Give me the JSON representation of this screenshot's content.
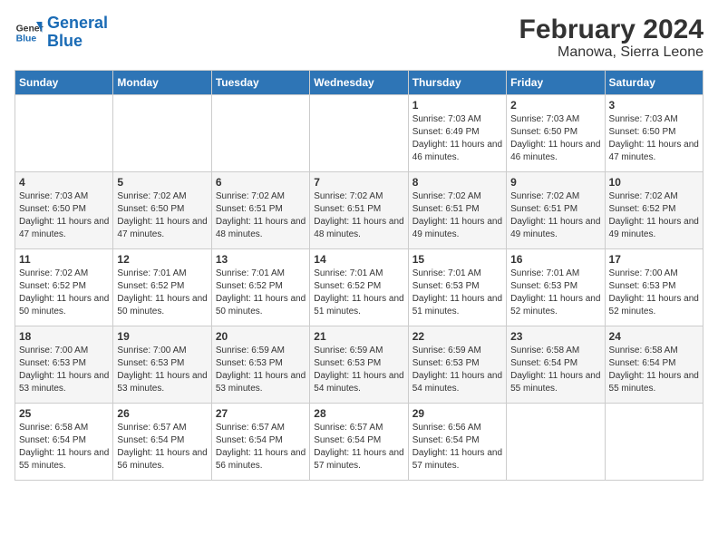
{
  "logo": {
    "line1": "General",
    "line2": "Blue"
  },
  "title": "February 2024",
  "subtitle": "Manowa, Sierra Leone",
  "days_of_week": [
    "Sunday",
    "Monday",
    "Tuesday",
    "Wednesday",
    "Thursday",
    "Friday",
    "Saturday"
  ],
  "weeks": [
    [
      {
        "num": "",
        "detail": ""
      },
      {
        "num": "",
        "detail": ""
      },
      {
        "num": "",
        "detail": ""
      },
      {
        "num": "",
        "detail": ""
      },
      {
        "num": "1",
        "detail": "Sunrise: 7:03 AM\nSunset: 6:49 PM\nDaylight: 11 hours and 46 minutes."
      },
      {
        "num": "2",
        "detail": "Sunrise: 7:03 AM\nSunset: 6:50 PM\nDaylight: 11 hours and 46 minutes."
      },
      {
        "num": "3",
        "detail": "Sunrise: 7:03 AM\nSunset: 6:50 PM\nDaylight: 11 hours and 47 minutes."
      }
    ],
    [
      {
        "num": "4",
        "detail": "Sunrise: 7:03 AM\nSunset: 6:50 PM\nDaylight: 11 hours and 47 minutes."
      },
      {
        "num": "5",
        "detail": "Sunrise: 7:02 AM\nSunset: 6:50 PM\nDaylight: 11 hours and 47 minutes."
      },
      {
        "num": "6",
        "detail": "Sunrise: 7:02 AM\nSunset: 6:51 PM\nDaylight: 11 hours and 48 minutes."
      },
      {
        "num": "7",
        "detail": "Sunrise: 7:02 AM\nSunset: 6:51 PM\nDaylight: 11 hours and 48 minutes."
      },
      {
        "num": "8",
        "detail": "Sunrise: 7:02 AM\nSunset: 6:51 PM\nDaylight: 11 hours and 49 minutes."
      },
      {
        "num": "9",
        "detail": "Sunrise: 7:02 AM\nSunset: 6:51 PM\nDaylight: 11 hours and 49 minutes."
      },
      {
        "num": "10",
        "detail": "Sunrise: 7:02 AM\nSunset: 6:52 PM\nDaylight: 11 hours and 49 minutes."
      }
    ],
    [
      {
        "num": "11",
        "detail": "Sunrise: 7:02 AM\nSunset: 6:52 PM\nDaylight: 11 hours and 50 minutes."
      },
      {
        "num": "12",
        "detail": "Sunrise: 7:01 AM\nSunset: 6:52 PM\nDaylight: 11 hours and 50 minutes."
      },
      {
        "num": "13",
        "detail": "Sunrise: 7:01 AM\nSunset: 6:52 PM\nDaylight: 11 hours and 50 minutes."
      },
      {
        "num": "14",
        "detail": "Sunrise: 7:01 AM\nSunset: 6:52 PM\nDaylight: 11 hours and 51 minutes."
      },
      {
        "num": "15",
        "detail": "Sunrise: 7:01 AM\nSunset: 6:53 PM\nDaylight: 11 hours and 51 minutes."
      },
      {
        "num": "16",
        "detail": "Sunrise: 7:01 AM\nSunset: 6:53 PM\nDaylight: 11 hours and 52 minutes."
      },
      {
        "num": "17",
        "detail": "Sunrise: 7:00 AM\nSunset: 6:53 PM\nDaylight: 11 hours and 52 minutes."
      }
    ],
    [
      {
        "num": "18",
        "detail": "Sunrise: 7:00 AM\nSunset: 6:53 PM\nDaylight: 11 hours and 53 minutes."
      },
      {
        "num": "19",
        "detail": "Sunrise: 7:00 AM\nSunset: 6:53 PM\nDaylight: 11 hours and 53 minutes."
      },
      {
        "num": "20",
        "detail": "Sunrise: 6:59 AM\nSunset: 6:53 PM\nDaylight: 11 hours and 53 minutes."
      },
      {
        "num": "21",
        "detail": "Sunrise: 6:59 AM\nSunset: 6:53 PM\nDaylight: 11 hours and 54 minutes."
      },
      {
        "num": "22",
        "detail": "Sunrise: 6:59 AM\nSunset: 6:53 PM\nDaylight: 11 hours and 54 minutes."
      },
      {
        "num": "23",
        "detail": "Sunrise: 6:58 AM\nSunset: 6:54 PM\nDaylight: 11 hours and 55 minutes."
      },
      {
        "num": "24",
        "detail": "Sunrise: 6:58 AM\nSunset: 6:54 PM\nDaylight: 11 hours and 55 minutes."
      }
    ],
    [
      {
        "num": "25",
        "detail": "Sunrise: 6:58 AM\nSunset: 6:54 PM\nDaylight: 11 hours and 55 minutes."
      },
      {
        "num": "26",
        "detail": "Sunrise: 6:57 AM\nSunset: 6:54 PM\nDaylight: 11 hours and 56 minutes."
      },
      {
        "num": "27",
        "detail": "Sunrise: 6:57 AM\nSunset: 6:54 PM\nDaylight: 11 hours and 56 minutes."
      },
      {
        "num": "28",
        "detail": "Sunrise: 6:57 AM\nSunset: 6:54 PM\nDaylight: 11 hours and 57 minutes."
      },
      {
        "num": "29",
        "detail": "Sunrise: 6:56 AM\nSunset: 6:54 PM\nDaylight: 11 hours and 57 minutes."
      },
      {
        "num": "",
        "detail": ""
      },
      {
        "num": "",
        "detail": ""
      }
    ]
  ]
}
